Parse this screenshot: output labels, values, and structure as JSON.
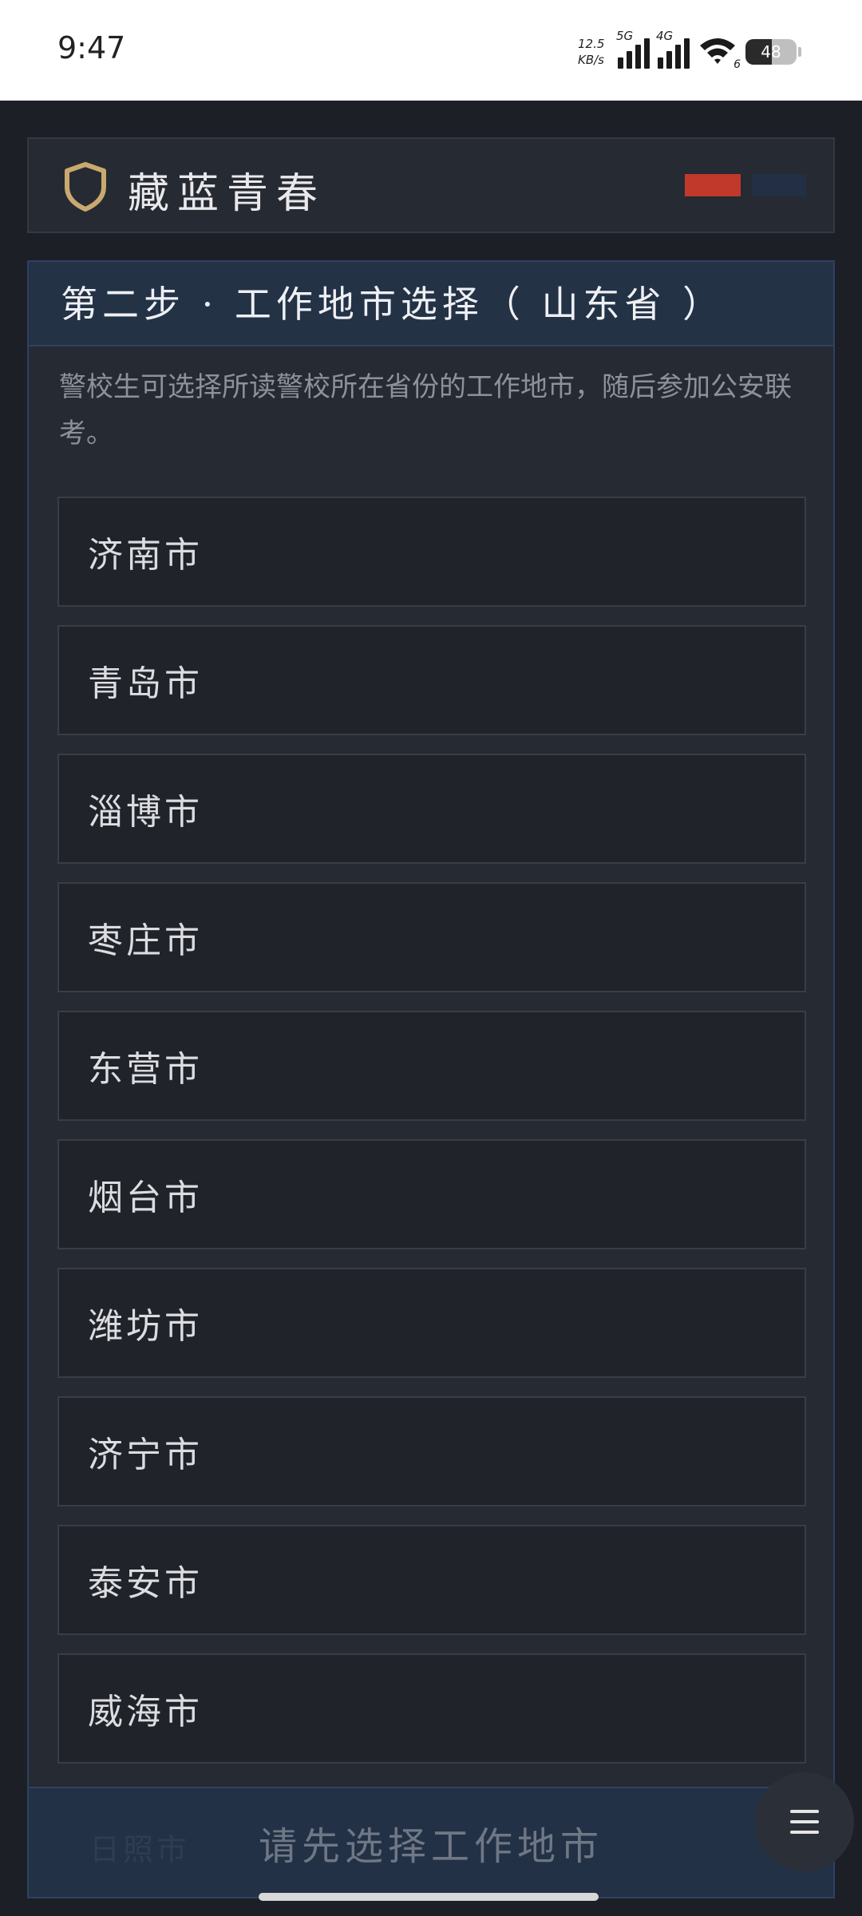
{
  "status_bar": {
    "time": "9:47",
    "net_speed_value": "12.5",
    "net_speed_unit": "KB/s",
    "sim1_tag": "5G",
    "sim2_tag": "4G",
    "wifi_tag": "6",
    "battery": "48"
  },
  "header": {
    "brand": "藏蓝青春",
    "icon": "shield-icon",
    "flag_colors": [
      "#c0392b",
      "#232f44"
    ]
  },
  "step": {
    "title": "第二步 · 工作地市选择（ 山东省 ）",
    "description": "警校生可选择所读警校所在省份的工作地市，随后参加公安联考。",
    "cities": [
      "济南市",
      "青岛市",
      "淄博市",
      "枣庄市",
      "东营市",
      "烟台市",
      "潍坊市",
      "济宁市",
      "泰安市",
      "威海市"
    ]
  },
  "bottom_bar": {
    "ghost_label": "日照市",
    "label": "请先选择工作地市"
  },
  "fab": {
    "icon": "menu-icon"
  },
  "colors": {
    "background": "#1c1f26",
    "card": "#262a33",
    "header_bar": "#243246",
    "accent_gold": "#c9a96e"
  }
}
